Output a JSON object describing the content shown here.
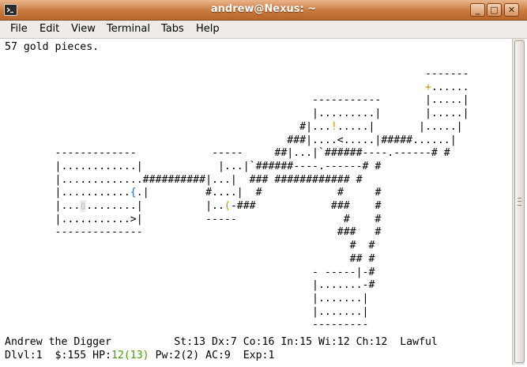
{
  "window": {
    "title": "andrew@Nexus: ~"
  },
  "titlebar_buttons": {
    "minimize": "_",
    "maximize": "□",
    "close": "✕"
  },
  "menu": [
    "File",
    "Edit",
    "View",
    "Terminal",
    "Tabs",
    "Help"
  ],
  "terminal": {
    "message": "57 gold pieces.",
    "map_rows": [
      "                                                                   -------",
      "                                                                   +......",
      "                                                 -----------       |.....|",
      "                                                 |.........|       |.....|",
      "                                               #|...!.....|       |.....|",
      "                                             ###|....<.....|#####......|",
      "        -------------            -----     ##|...|`######----.------# #",
      "        |............|            |...|`######----.------# #",
      "        |.............##########|...|  ### ############ #",
      "        |...........{.|         #....|  #            #     #",
      "        |...▯........|          |..(-###            ###    #",
      "        |...........>|          -----                 #    #",
      "        --------------                               ###   #",
      "                                                       #  #",
      "                                                       ## #",
      "                                                 - -----|-#",
      "                                                 |.......-#",
      "                                                 |.......|",
      "                                                 |.......|",
      "                                                 ---------"
    ],
    "status_line1": "Andrew the Digger          St:13 Dx:7 Co:16 In:15 Wi:12 Ch:12  Lawful",
    "status_line2": {
      "prefix": "Dlvl:1  $:155 HP:",
      "hp": "12(13)",
      "suffix": " Pw:2(2) AC:9  Exp:1"
    }
  },
  "colors": {
    "gold": "#c9a800",
    "door": "#d88a00",
    "fountain": "#1f6fb5",
    "hp_ok": "#4a9a06"
  }
}
